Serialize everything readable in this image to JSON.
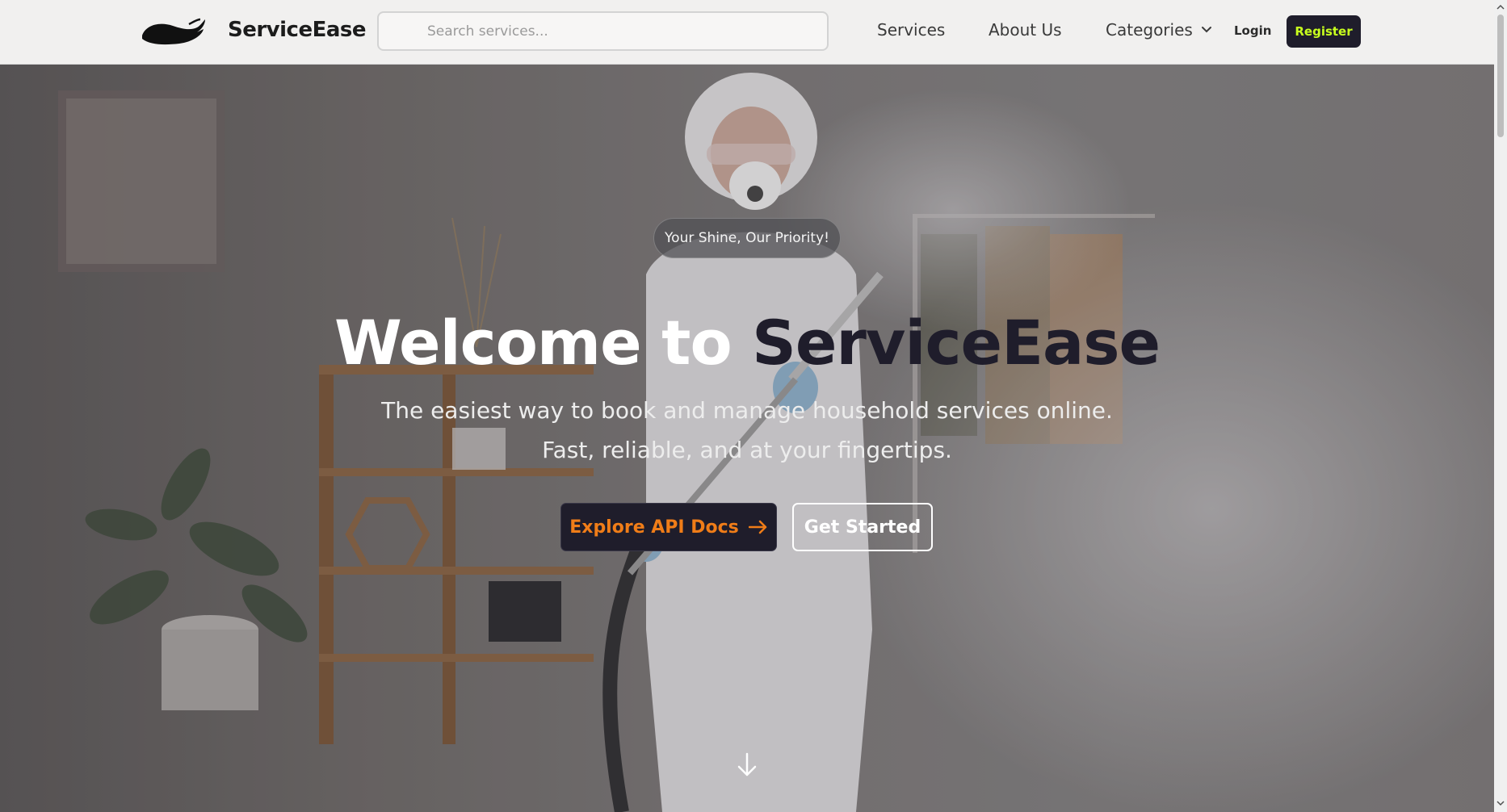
{
  "brand": {
    "name": "ServiceEase",
    "logo_icon": "hand-icon"
  },
  "search": {
    "placeholder": "Search services..."
  },
  "nav": {
    "services": "Services",
    "about": "About Us",
    "categories": "Categories",
    "login": "Login",
    "register": "Register"
  },
  "hero": {
    "tagline": "Your Shine, Our Priority!",
    "title_part1": "Welcome to",
    "title_part2": "ServiceEase",
    "subtitle": "The easiest way to book and manage household services online. Fast, reliable, and at your fingertips.",
    "btn_api": "Explore API Docs",
    "btn_start": "Get Started"
  },
  "colors": {
    "dark": "#1f1d2b",
    "register_text": "#c8ff1e",
    "api_text": "#f07d18",
    "header_bg": "#f1f0ef"
  }
}
